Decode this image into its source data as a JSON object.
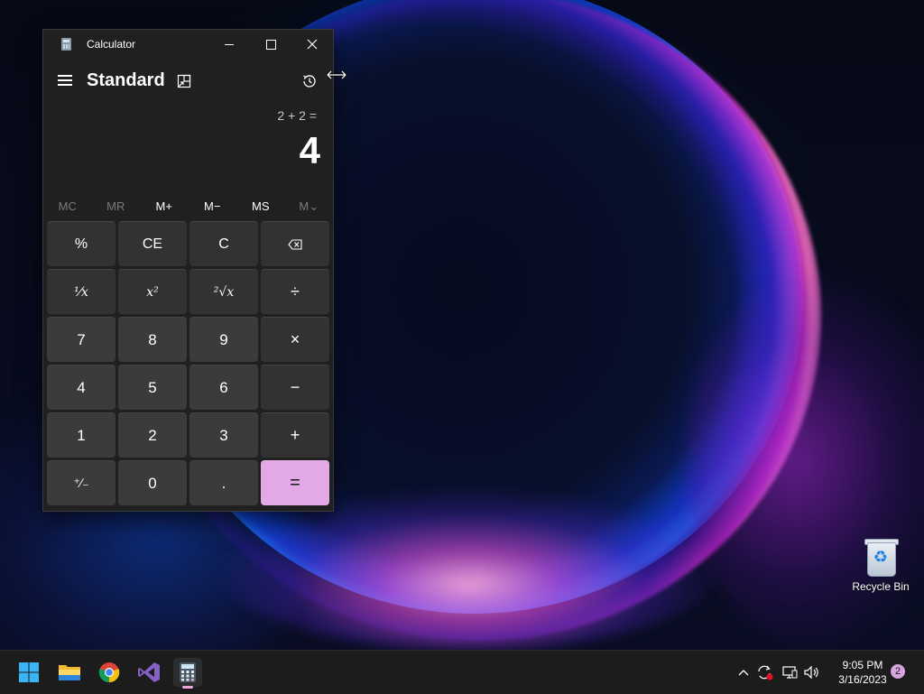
{
  "desktop": {
    "icons": [
      {
        "label": "Recycle Bin",
        "icon": "recycle-bin-icon"
      }
    ]
  },
  "calculator": {
    "window_title": "Calculator",
    "mode": "Standard",
    "expression": "2 + 2 =",
    "display": "4",
    "memory_buttons": [
      "MC",
      "MR",
      "M+",
      "M−",
      "MS",
      "M⌄"
    ],
    "memory_enabled": [
      false,
      false,
      true,
      true,
      true,
      false
    ],
    "keys": {
      "percent": "%",
      "clear_entry": "CE",
      "clear": "C",
      "backspace": "⌫",
      "reciprocal": "⅟x",
      "square": "x²",
      "sqrt": "²√x",
      "divide": "÷",
      "seven": "7",
      "eight": "8",
      "nine": "9",
      "multiply": "×",
      "four": "4",
      "five": "5",
      "six": "6",
      "subtract": "−",
      "one": "1",
      "two": "2",
      "three": "3",
      "add": "+",
      "negate": "⁺∕₋",
      "zero": "0",
      "decimal": ".",
      "equals": "="
    },
    "colors": {
      "background": "#202020",
      "key": "#3b3b3b",
      "accent": "#e3a8e6"
    }
  },
  "taskbar": {
    "apps": [
      "start-icon",
      "file-explorer-icon",
      "chrome-icon",
      "visual-studio-icon",
      "calculator-icon"
    ],
    "active_app": "calculator-icon",
    "tray": {
      "time": "9:05 PM",
      "date": "3/16/2023",
      "notification_count": "2"
    }
  }
}
